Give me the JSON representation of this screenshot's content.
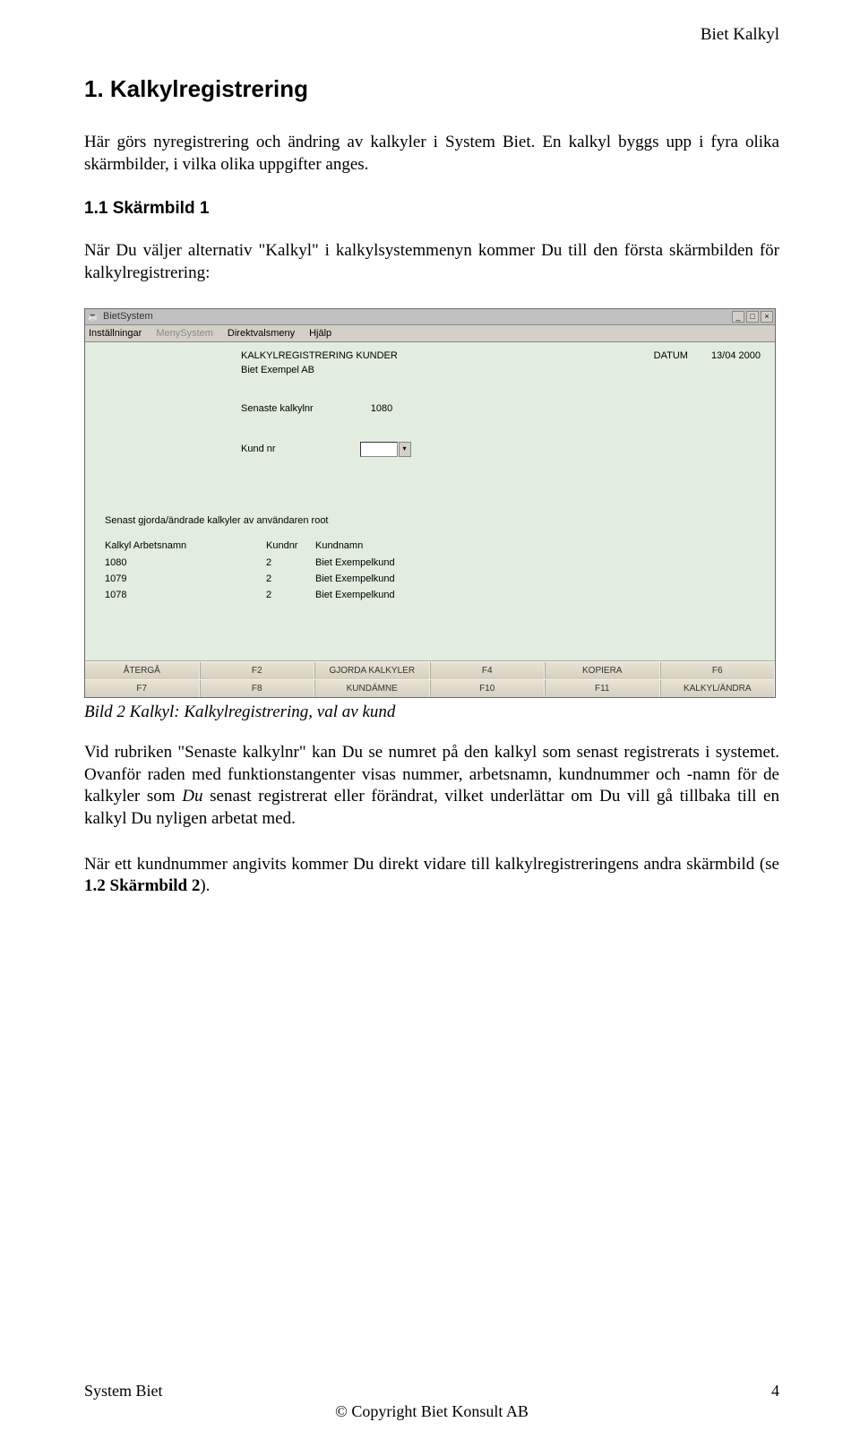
{
  "page_header_right": "Biet Kalkyl",
  "section_title": "1. Kalkylregistrering",
  "intro_text": "Här görs nyregistrering och ändring av kalkyler i System Biet. En kalkyl byggs upp i fyra olika skärmbilder, i vilka olika uppgifter anges.",
  "subsection_title": "1.1 Skärmbild 1",
  "subsection_text": "När Du väljer alternativ \"Kalkyl\" i kalkylsystemmenyn kommer Du till den första skärmbilden för kalkylregistrering:",
  "caption": "Bild 2 Kalkyl: Kalkylregistrering, val av kund",
  "body_para_1_a": "Vid rubriken \"Senaste kalkylnr\" kan Du se numret på den kalkyl som senast registrerats i systemet. Ovanför raden med funktionstangenter visas nummer, arbetsnamn, kundnummer och -namn för de kalkyler som ",
  "body_para_1_du": "Du",
  "body_para_1_b": " senast registrerat eller förändrat, vilket underlättar om Du vill gå tillbaka till en kalkyl Du nyligen arbetat med.",
  "body_para_2_a": "När ett kundnummer angivits kommer Du direkt vidare till kalkylregistreringens andra skärmbild (se ",
  "body_para_2_bold": "1.2 Skärmbild 2",
  "body_para_2_b": ").",
  "footer_left": "System Biet",
  "footer_page": "4",
  "footer_center": "© Copyright Biet Konsult AB",
  "app": {
    "title": "BietSystem",
    "menu": {
      "installningar": "Inställningar",
      "menysystem": "MenySystem",
      "direktvalsmeny": "Direktvalsmeny",
      "hjalp": "Hjälp"
    },
    "heading": "KALKYLREGISTRERING KUNDER",
    "date_label": "DATUM",
    "date_value": "13/04 2000",
    "company": "Biet Exempel AB",
    "senaste_label": "Senaste kalkylnr",
    "senaste_value": "1080",
    "kundnr_label": "Kund nr",
    "recent_title": "Senast gjorda/ändrade kalkyler av användaren root",
    "recent_headers": {
      "kalkyl_arbets": "Kalkyl Arbetsnamn",
      "kundnr": "Kundnr",
      "kundnamn": "Kundnamn"
    },
    "recent_rows": [
      {
        "kalkyl": "1080",
        "kundnr": "2",
        "kundnamn": "Biet Exempelkund"
      },
      {
        "kalkyl": "1079",
        "kundnr": "2",
        "kundnamn": "Biet Exempelkund"
      },
      {
        "kalkyl": "1078",
        "kundnr": "2",
        "kundnamn": "Biet Exempelkund"
      }
    ],
    "fkeys_row1": [
      "ÅTERGÅ",
      "F2",
      "GJORDA KALKYLER",
      "F4",
      "KOPIERA",
      "F6"
    ],
    "fkeys_row2": [
      "F7",
      "F8",
      "KUNDÄMNE",
      "F10",
      "F11",
      "KALKYL/ÄNDRA"
    ]
  }
}
